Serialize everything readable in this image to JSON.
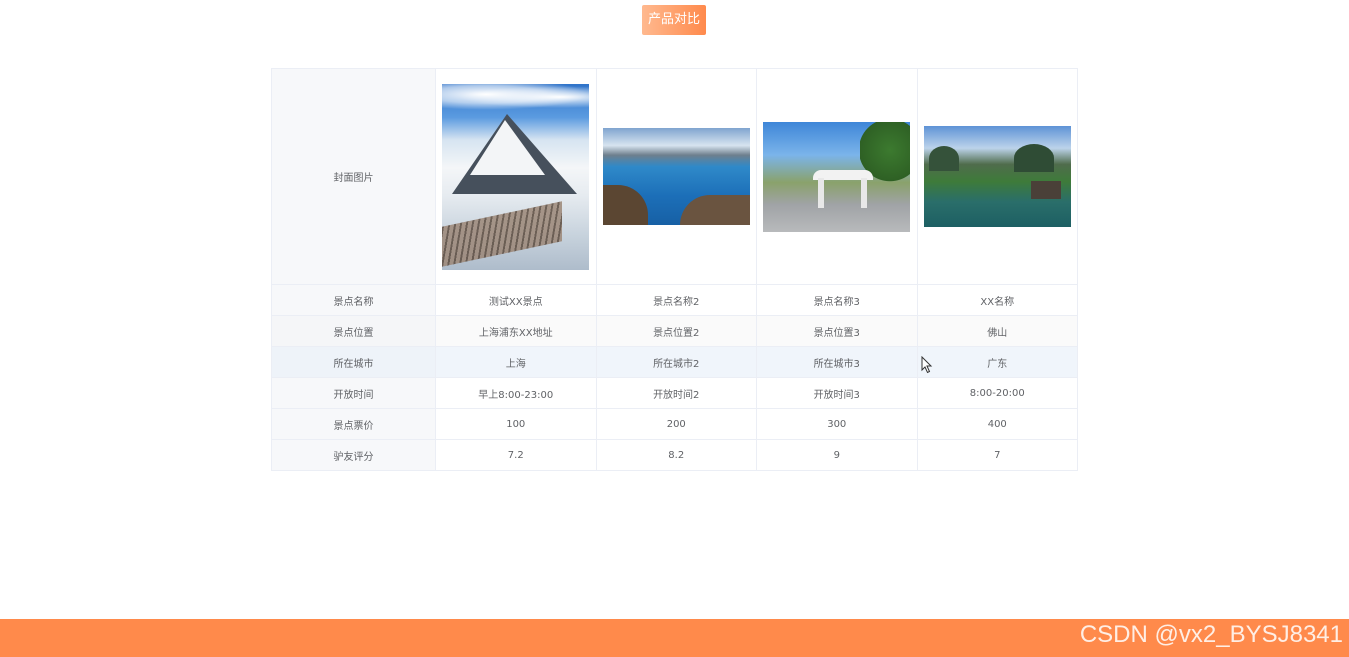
{
  "header": {
    "compare_button": "产品对比"
  },
  "table": {
    "row_labels": {
      "cover": "封面图片",
      "name": "景点名称",
      "location": "景点位置",
      "city": "所在城市",
      "hours": "开放时间",
      "price": "景点票价",
      "rating": "驴友评分"
    },
    "products": [
      {
        "cover_icon": "snow-mountain-image",
        "name": "测试XX景点",
        "location": "上海浦东XX地址",
        "city": "上海",
        "hours": "早上8:00-23:00",
        "price": "100",
        "rating": "7.2"
      },
      {
        "cover_icon": "lake-image",
        "name": "景点名称2",
        "location": "景点位置2",
        "city": "所在城市2",
        "hours": "开放时间2",
        "price": "200",
        "rating": "8.2"
      },
      {
        "cover_icon": "gate-image",
        "name": "景点名称3",
        "location": "景点位置3",
        "city": "所在城市3",
        "hours": "开放时间3",
        "price": "300",
        "rating": "9"
      },
      {
        "cover_icon": "karst-landscape-image",
        "name": "XX名称",
        "location": "佛山",
        "city": "广东",
        "hours": "8:00-20:00",
        "price": "400",
        "rating": "7"
      }
    ]
  },
  "watermark": "CSDN @vx2_BYSJ8341",
  "colors": {
    "accent": "#ff8a4b",
    "border": "#ebeef5",
    "header_cell": "#f7f8fa",
    "text": "#606266"
  }
}
